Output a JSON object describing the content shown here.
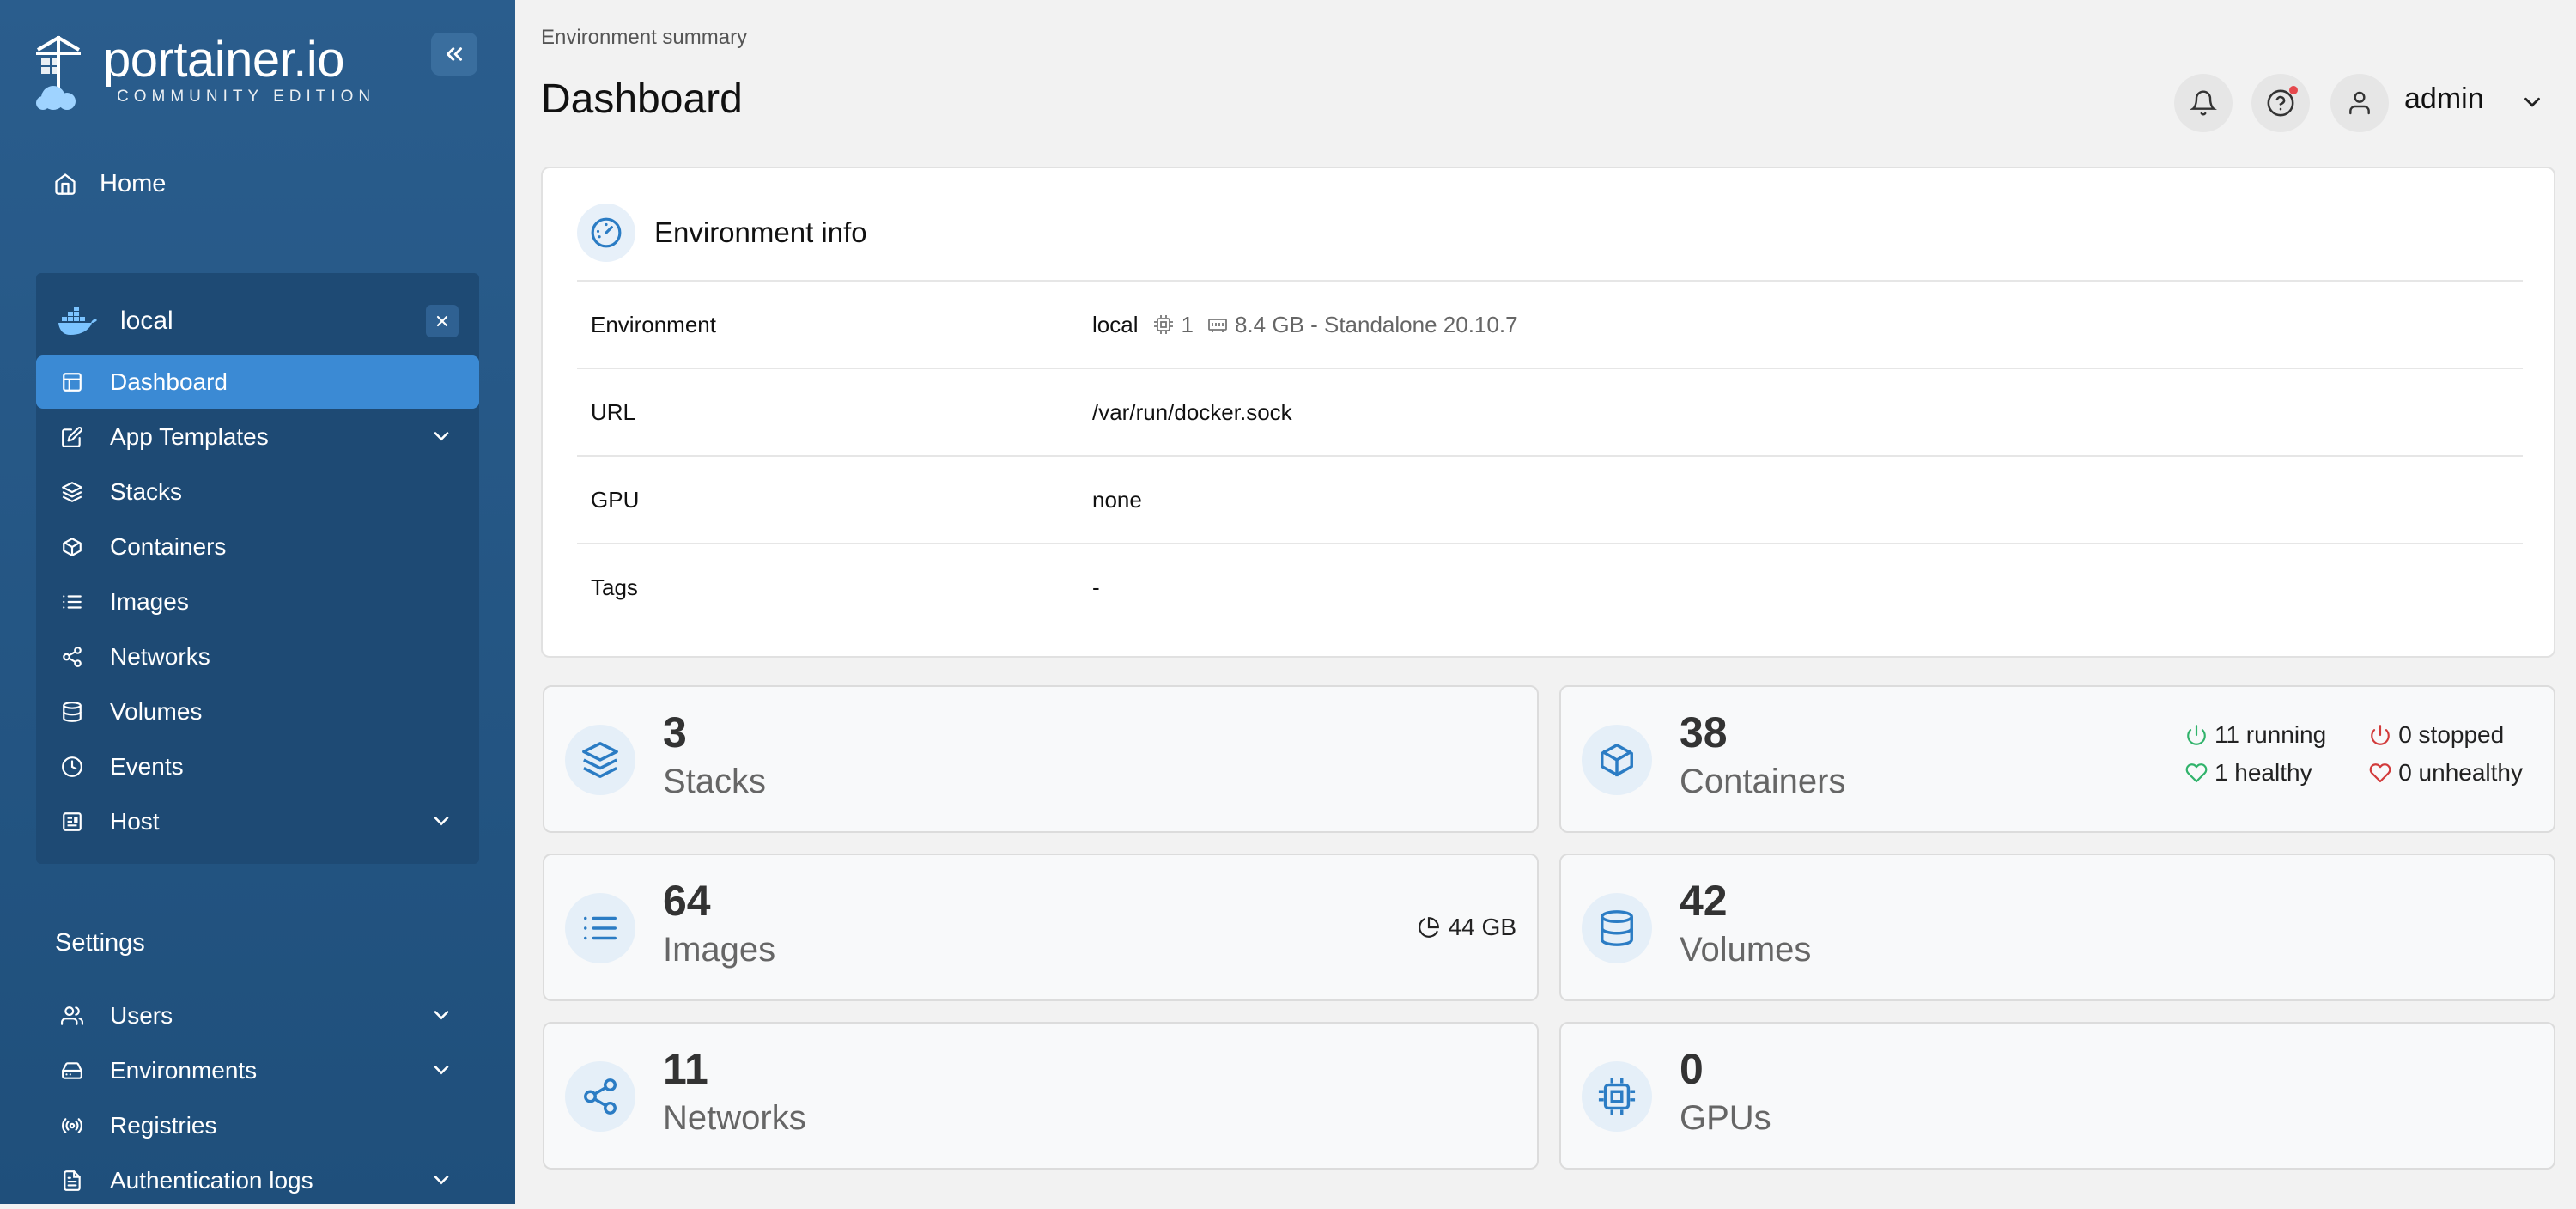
{
  "app": {
    "logo_word": "portainer.io",
    "logo_edition": "COMMUNITY EDITION"
  },
  "sidebar": {
    "home_label": "Home",
    "environment_name": "local",
    "menu": [
      {
        "label": "Dashboard",
        "icon": "layout-icon",
        "active": true
      },
      {
        "label": "App Templates",
        "icon": "edit-icon",
        "expandable": true
      },
      {
        "label": "Stacks",
        "icon": "layers-icon"
      },
      {
        "label": "Containers",
        "icon": "box-icon"
      },
      {
        "label": "Images",
        "icon": "list-icon"
      },
      {
        "label": "Networks",
        "icon": "share-icon"
      },
      {
        "label": "Volumes",
        "icon": "database-icon"
      },
      {
        "label": "Events",
        "icon": "clock-icon"
      },
      {
        "label": "Host",
        "icon": "host-icon",
        "expandable": true
      }
    ],
    "settings_label": "Settings",
    "settings_menu": [
      {
        "label": "Users",
        "icon": "users-icon",
        "expandable": true
      },
      {
        "label": "Environments",
        "icon": "hard-drive-icon",
        "expandable": true
      },
      {
        "label": "Registries",
        "icon": "radio-icon"
      },
      {
        "label": "Authentication logs",
        "icon": "file-text-icon",
        "expandable": true
      }
    ]
  },
  "header": {
    "breadcrumb": "Environment summary",
    "title": "Dashboard",
    "username": "admin"
  },
  "env_info": {
    "title": "Environment info",
    "rows": [
      {
        "key": "Environment",
        "value": "local",
        "cpu": "1",
        "memory": "8.4 GB - Standalone 20.10.7"
      },
      {
        "key": "URL",
        "value": "/var/run/docker.sock"
      },
      {
        "key": "GPU",
        "value": "none"
      },
      {
        "key": "Tags",
        "value": "-"
      }
    ]
  },
  "tiles": {
    "stacks": {
      "count": "3",
      "label": "Stacks"
    },
    "containers": {
      "count": "38",
      "label": "Containers",
      "running": "11 running",
      "stopped": "0 stopped",
      "healthy": "1 healthy",
      "unhealthy": "0 unhealthy"
    },
    "images": {
      "count": "64",
      "label": "Images",
      "size": "44 GB"
    },
    "volumes": {
      "count": "42",
      "label": "Volumes"
    },
    "networks": {
      "count": "11",
      "label": "Networks"
    },
    "gpus": {
      "count": "0",
      "label": "GPUs"
    }
  },
  "colors": {
    "sidebar_bg": "#2a5d8d",
    "active_item": "#3b8ad4",
    "accent": "#2b7cc4",
    "running": "#31b36b",
    "stopped": "#d23b3b"
  }
}
